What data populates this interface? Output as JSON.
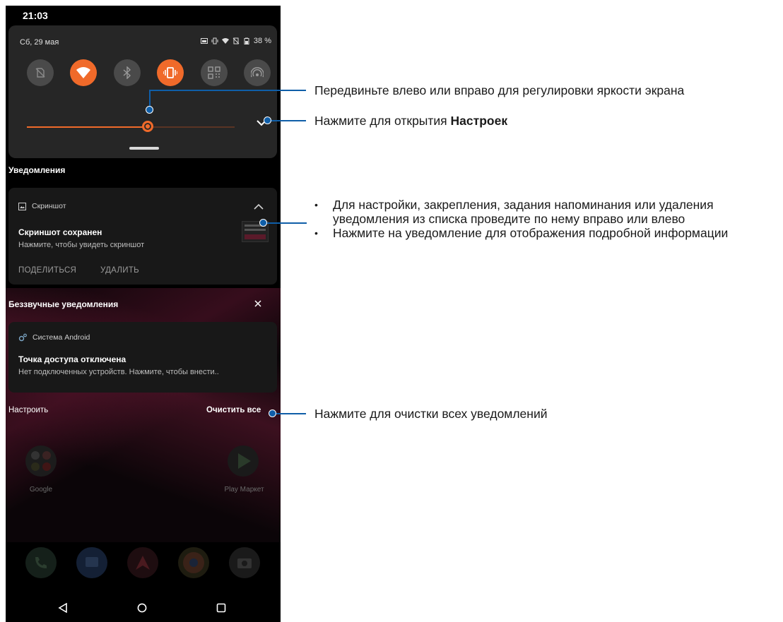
{
  "status_bar": {
    "time": "21:03"
  },
  "quick_settings": {
    "date": "Сб, 29 мая",
    "battery": "38 %",
    "tiles": [
      {
        "name": "no-sim-icon",
        "active": false
      },
      {
        "name": "wifi-icon",
        "active": true
      },
      {
        "name": "bluetooth-icon",
        "active": false
      },
      {
        "name": "vibrate-icon",
        "active": true
      },
      {
        "name": "qr-scan-icon",
        "active": false
      },
      {
        "name": "hotspot-icon",
        "active": false
      }
    ],
    "brightness_level": 0.58
  },
  "notifications": {
    "header": "Уведомления",
    "screenshot": {
      "app": "Скриншот",
      "title": "Скриншот сохранен",
      "text": "Нажмите, чтобы увидеть скриншот",
      "action_share": "ПОДЕЛИТЬСЯ",
      "action_delete": "УДАЛИТЬ"
    },
    "silent_header": "Беззвучные уведомления",
    "android": {
      "app": "Система Android",
      "title": "Точка доступа отключена",
      "text": "Нет подключенных устройств. Нажмите, чтобы внести.."
    },
    "footer_manage": "Настроить",
    "footer_clear": "Очистить все"
  },
  "home": {
    "google_label": "Google",
    "play_label": "Play Маркет"
  },
  "callouts": {
    "brightness": "Передвиньте влево или вправо для регулировки яркости экрана",
    "settings_prefix": "Нажмите для открытия ",
    "settings_bold": "Настроек",
    "swipe_bullet": "Для настройки, закрепления, задания напоминания или удаления",
    "swipe_bullet_cont": "уведомления из списка проведите по нему вправо или влево",
    "tap_bullet": "Нажмите на уведомление для отображения подробной информации",
    "clear_all": "Нажмите для очистки всех уведомлений"
  },
  "colors": {
    "accent": "#f06a2a",
    "callout": "#0f5ea8",
    "panel": "#262626"
  }
}
